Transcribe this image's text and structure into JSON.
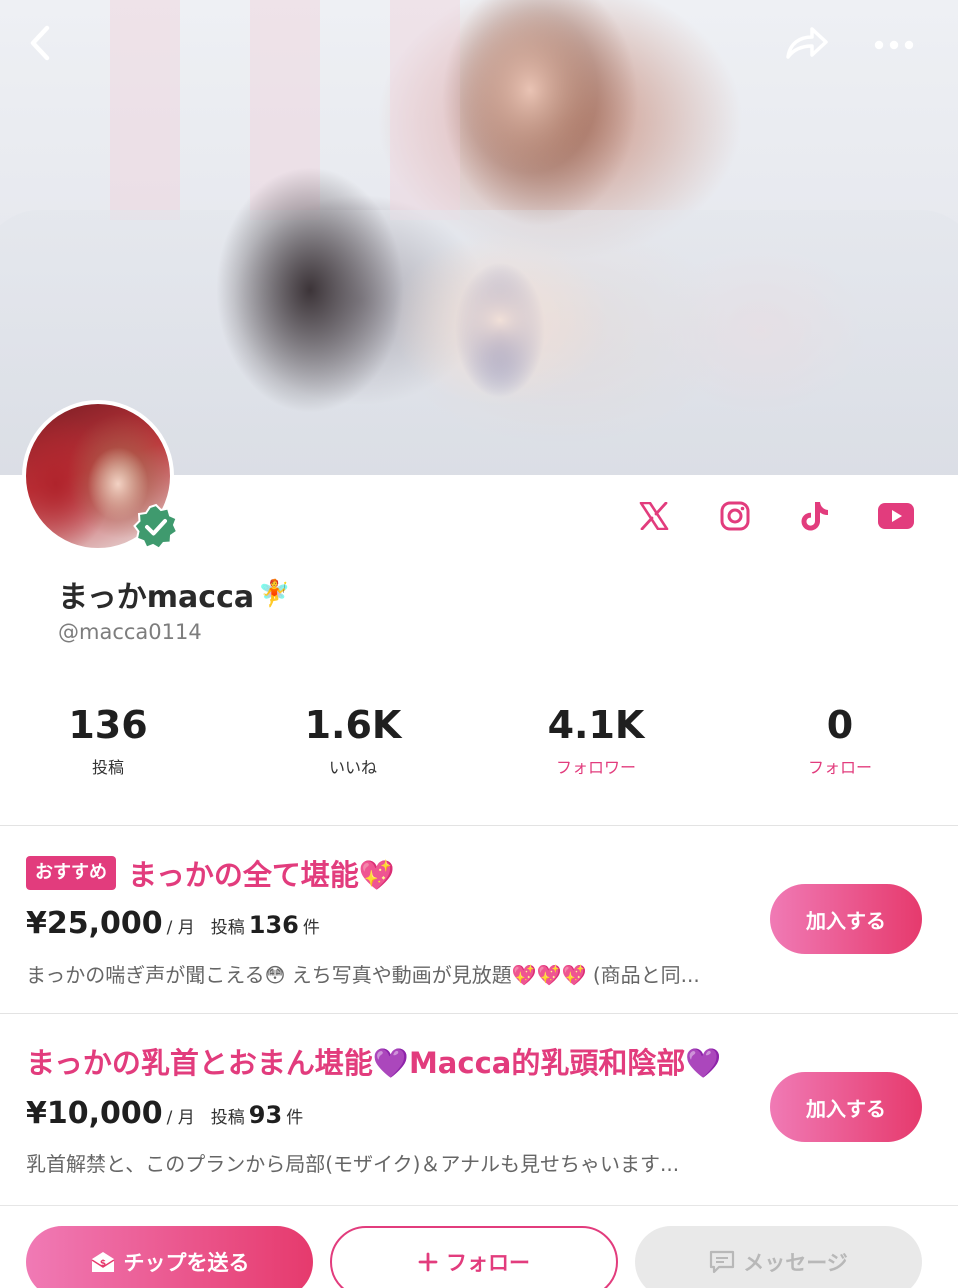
{
  "header": {
    "back_icon": "chevron-left-icon",
    "share_icon": "share-arrow-icon",
    "more_icon": "ellipsis-icon"
  },
  "profile": {
    "display_name": "まっかmacca",
    "name_emoji": "🧚",
    "handle": "@macca0114",
    "verified": true,
    "socials": [
      "x-icon",
      "instagram-icon",
      "tiktok-icon",
      "youtube-icon"
    ]
  },
  "stats": [
    {
      "value": "136",
      "label": "投稿"
    },
    {
      "value": "1.6K",
      "label": "いいね"
    },
    {
      "value": "4.1K",
      "label": "フォロワー"
    },
    {
      "value": "0",
      "label": "フォロー"
    }
  ],
  "plans": [
    {
      "badge": "おすすめ",
      "title": "まっかの全て堪能💖",
      "price": "¥25,000",
      "per": "/ 月",
      "posts_label": "投稿",
      "posts_count": "136",
      "posts_unit": "件",
      "description": "まっかの喘ぎ声が聞こえる😳 えち写真や動画が見放題💖💖💖 (商品と同...",
      "button": "加入する"
    },
    {
      "title": "まっかの乳首とおまん堪能💜Macca的乳頭和陰部💜",
      "price": "¥10,000",
      "per": "/ 月",
      "posts_label": "投稿",
      "posts_count": "93",
      "posts_unit": "件",
      "description": "乳首解禁と、このプランから局部(モザイク)＆アナルも見せちゃいます...",
      "button": "加入する"
    }
  ],
  "bottom_bar": {
    "tip": "チップを送る",
    "follow": "フォロー",
    "message": "メッセージ"
  },
  "colors": {
    "accent": "#e23c7d",
    "gradient_start": "#f07ab5",
    "gradient_end": "#e63a6d",
    "verified": "#3f9a6e",
    "disabled": "#e9e9e9"
  }
}
